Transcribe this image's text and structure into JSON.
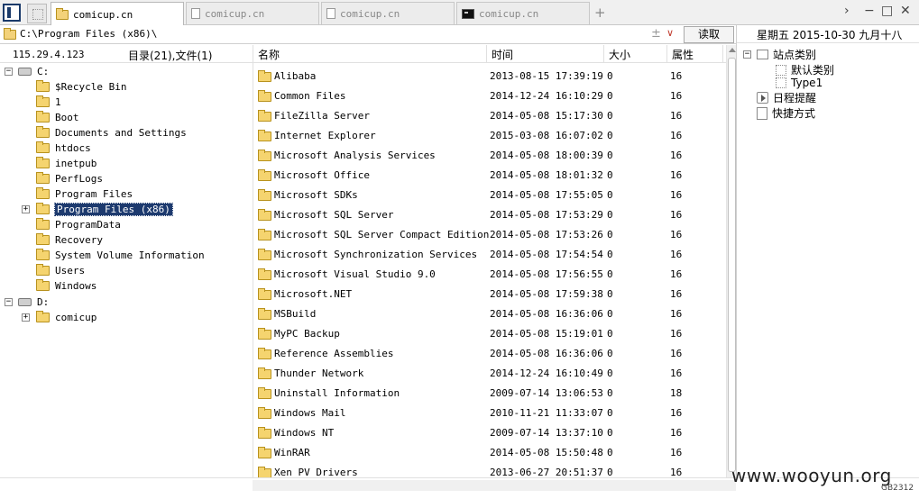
{
  "tabs": [
    {
      "label": "comicup.cn",
      "icon": "folder-icon",
      "active": true
    },
    {
      "label": "comicup.cn",
      "icon": "document-icon",
      "active": false
    },
    {
      "label": "comicup.cn",
      "icon": "document-icon",
      "active": false
    },
    {
      "label": "comicup.cn",
      "icon": "terminal-icon",
      "active": false
    }
  ],
  "tabbar": {
    "add": "+",
    "chevron": "›",
    "minimize": "−",
    "maximize": "□",
    "close": "✕"
  },
  "path": {
    "value": "C:\\Program Files (x86)\\",
    "plus": "±",
    "dropdown": "∨",
    "read_button": "读取"
  },
  "status": {
    "ip": "115.29.4.123",
    "dir_count": "目录(21),文件(1)"
  },
  "tree": [
    {
      "label": "C:",
      "type": "drive",
      "level": 0,
      "expander": "−"
    },
    {
      "label": "$Recycle Bin",
      "type": "folder",
      "level": 1
    },
    {
      "label": "1",
      "type": "folder",
      "level": 1
    },
    {
      "label": "Boot",
      "type": "folder",
      "level": 1
    },
    {
      "label": "Documents and Settings",
      "type": "folder",
      "level": 1
    },
    {
      "label": "htdocs",
      "type": "folder",
      "level": 1
    },
    {
      "label": "inetpub",
      "type": "folder",
      "level": 1
    },
    {
      "label": "PerfLogs",
      "type": "folder",
      "level": 1
    },
    {
      "label": "Program Files",
      "type": "folder",
      "level": 1
    },
    {
      "label": "Program Files (x86)",
      "type": "folder",
      "level": 1,
      "expander": "+",
      "selected": true
    },
    {
      "label": "ProgramData",
      "type": "folder",
      "level": 1
    },
    {
      "label": "Recovery",
      "type": "folder",
      "level": 1
    },
    {
      "label": "System Volume Information",
      "type": "folder",
      "level": 1
    },
    {
      "label": "Users",
      "type": "folder",
      "level": 1
    },
    {
      "label": "Windows",
      "type": "folder",
      "level": 1
    },
    {
      "label": "D:",
      "type": "drive",
      "level": 0,
      "expander": "−"
    },
    {
      "label": "comicup",
      "type": "folder",
      "level": 1,
      "expander": "+"
    }
  ],
  "columns": {
    "name": "名称",
    "time": "时间",
    "size": "大小",
    "attr": "属性"
  },
  "files": [
    {
      "name": "Alibaba",
      "time": "2013-08-15 17:39:19",
      "size": "0",
      "attr": "16"
    },
    {
      "name": "Common Files",
      "time": "2014-12-24 16:10:29",
      "size": "0",
      "attr": "16"
    },
    {
      "name": "FileZilla Server",
      "time": "2014-05-08 15:17:30",
      "size": "0",
      "attr": "16"
    },
    {
      "name": "Internet Explorer",
      "time": "2015-03-08 16:07:02",
      "size": "0",
      "attr": "16"
    },
    {
      "name": "Microsoft Analysis Services",
      "time": "2014-05-08 18:00:39",
      "size": "0",
      "attr": "16"
    },
    {
      "name": "Microsoft Office",
      "time": "2014-05-08 18:01:32",
      "size": "0",
      "attr": "16"
    },
    {
      "name": "Microsoft SDKs",
      "time": "2014-05-08 17:55:05",
      "size": "0",
      "attr": "16"
    },
    {
      "name": "Microsoft SQL Server",
      "time": "2014-05-08 17:53:29",
      "size": "0",
      "attr": "16"
    },
    {
      "name": "Microsoft SQL Server Compact Edition",
      "time": "2014-05-08 17:53:26",
      "size": "0",
      "attr": "16"
    },
    {
      "name": "Microsoft Synchronization Services",
      "time": "2014-05-08 17:54:54",
      "size": "0",
      "attr": "16"
    },
    {
      "name": "Microsoft Visual Studio 9.0",
      "time": "2014-05-08 17:56:55",
      "size": "0",
      "attr": "16"
    },
    {
      "name": "Microsoft.NET",
      "time": "2014-05-08 17:59:38",
      "size": "0",
      "attr": "16"
    },
    {
      "name": "MSBuild",
      "time": "2014-05-08 16:36:06",
      "size": "0",
      "attr": "16"
    },
    {
      "name": "MyPC Backup",
      "time": "2014-05-08 15:19:01",
      "size": "0",
      "attr": "16"
    },
    {
      "name": "Reference Assemblies",
      "time": "2014-05-08 16:36:06",
      "size": "0",
      "attr": "16"
    },
    {
      "name": "Thunder Network",
      "time": "2014-12-24 16:10:49",
      "size": "0",
      "attr": "16"
    },
    {
      "name": "Uninstall Information",
      "time": "2009-07-14 13:06:53",
      "size": "0",
      "attr": "18"
    },
    {
      "name": "Windows Mail",
      "time": "2010-11-21 11:33:07",
      "size": "0",
      "attr": "16"
    },
    {
      "name": "Windows NT",
      "time": "2009-07-14 13:37:10",
      "size": "0",
      "attr": "16"
    },
    {
      "name": "WinRAR",
      "time": "2014-05-08 15:50:48",
      "size": "0",
      "attr": "16"
    },
    {
      "name": "Xen PV Drivers",
      "time": "2013-06-27 20:51:37",
      "size": "0",
      "attr": "16"
    }
  ],
  "right_panel": {
    "date": "星期五 2015-10-30 九月十八",
    "items": [
      {
        "label": "站点类别",
        "icon": "category-icon",
        "expander": "−"
      },
      {
        "label": "默认类别",
        "icon": "subcategory-icon"
      },
      {
        "label": "Type1",
        "icon": "subcategory-icon"
      },
      {
        "label": "日程提醒",
        "icon": "reminder-icon"
      },
      {
        "label": "快捷方式",
        "icon": "shortcut-icon"
      }
    ]
  },
  "footer": {
    "watermark": "www.wooyun.org",
    "encoding": "GB2312"
  }
}
